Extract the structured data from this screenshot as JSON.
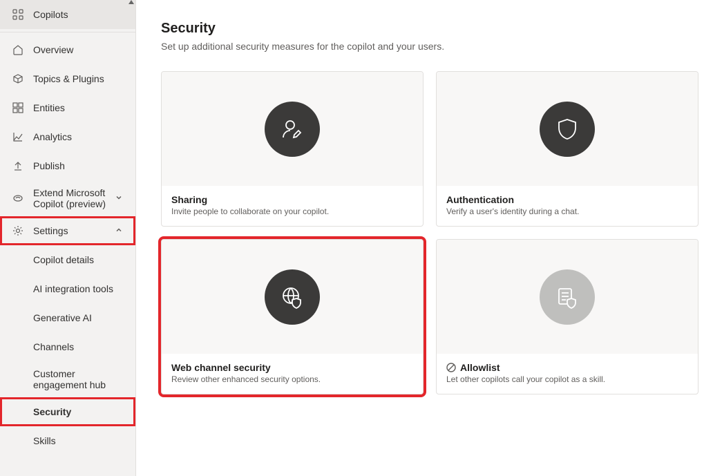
{
  "sidebar": {
    "copilots_label": "Copilots",
    "nav": {
      "overview": "Overview",
      "topics": "Topics & Plugins",
      "entities": "Entities",
      "analytics": "Analytics",
      "publish": "Publish",
      "extend": "Extend Microsoft Copilot (preview)",
      "settings": "Settings"
    },
    "settings_sub": {
      "copilot_details": "Copilot details",
      "ai_integration": "AI integration tools",
      "generative_ai": "Generative AI",
      "channels": "Channels",
      "customer_hub": "Customer engagement hub",
      "security": "Security",
      "skills": "Skills"
    }
  },
  "page": {
    "title": "Security",
    "subtitle": "Set up additional security measures for the copilot and your users."
  },
  "cards": {
    "sharing": {
      "title": "Sharing",
      "desc": "Invite people to collaborate on your copilot."
    },
    "authentication": {
      "title": "Authentication",
      "desc": "Verify a user's identity during a chat."
    },
    "web_channel": {
      "title": "Web channel security",
      "desc": "Review other enhanced security options."
    },
    "allowlist": {
      "title": "Allowlist",
      "desc": "Let other copilots call your copilot as a skill."
    }
  }
}
